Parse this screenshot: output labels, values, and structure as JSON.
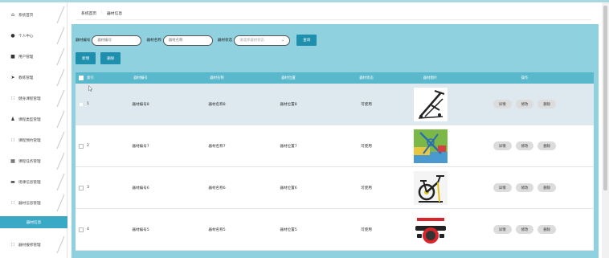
{
  "sidebar": {
    "items": [
      {
        "label": "系统首页",
        "icon": "home-icon",
        "glyph": "⌂"
      },
      {
        "label": "个人中心",
        "icon": "user-icon",
        "glyph": "●"
      },
      {
        "label": "用户管理",
        "icon": "users-icon",
        "glyph": "■"
      },
      {
        "label": "教练管理",
        "icon": "send-icon",
        "glyph": "➤"
      },
      {
        "label": "健身课程管理",
        "icon": "grid-icon",
        "glyph": "∷"
      },
      {
        "label": "课程类型管理",
        "icon": "person-icon",
        "glyph": "♟"
      },
      {
        "label": "课程预约管理",
        "icon": "grid-icon",
        "glyph": "∷"
      },
      {
        "label": "课程任务管理",
        "icon": "table-icon",
        "glyph": "▦"
      },
      {
        "label": "场课信息管理",
        "icon": "comment-icon",
        "glyph": "▬"
      },
      {
        "label": "器材信息管理",
        "icon": "grid-icon",
        "glyph": "∷"
      },
      {
        "label": "器材信息",
        "icon": "",
        "glyph": "",
        "active": true
      },
      {
        "label": "器材报修管理",
        "icon": "grid-icon",
        "glyph": "∷"
      }
    ]
  },
  "breadcrumb": {
    "home": "系统首页",
    "separator": "⋮",
    "current": "器材信息"
  },
  "search": {
    "code_label": "器材编号",
    "code_placeholder": "器材编号",
    "name_label": "器材名称",
    "name_placeholder": "器材名称",
    "status_label": "器材状态",
    "status_placeholder": "请选择器材状态",
    "query_button": "查询"
  },
  "actions": {
    "add": "新增",
    "delete": "删除"
  },
  "table": {
    "headers": {
      "index": "索引",
      "code": "器材编号",
      "name": "器材名称",
      "location": "器材位置",
      "status": "器材状态",
      "picture": "器材图片",
      "ops": "操作"
    },
    "rows": [
      {
        "index": "1",
        "code": "器材编号8",
        "name": "器材名称8",
        "location": "器材位置8",
        "status": "可使用",
        "pic": "ab-roller-frame"
      },
      {
        "index": "2",
        "code": "器材编号7",
        "name": "器材名称7",
        "location": "器材位置7",
        "status": "可使用",
        "pic": "outdoor-equipment"
      },
      {
        "index": "3",
        "code": "器材编号6",
        "name": "器材名称6",
        "location": "器材位置6",
        "status": "可使用",
        "pic": "spin-bike"
      },
      {
        "index": "4",
        "code": "器材编号5",
        "name": "器材名称5",
        "location": "器材位置5",
        "status": "可使用",
        "pic": "ab-wheel"
      }
    ],
    "op_labels": {
      "detail": "详情",
      "edit": "修改",
      "delete": "删除"
    }
  },
  "colors": {
    "panel": "#8fd1de",
    "header": "#5ab8cc",
    "button": "#1f8fae",
    "active_menu": "#3aa9c6"
  }
}
